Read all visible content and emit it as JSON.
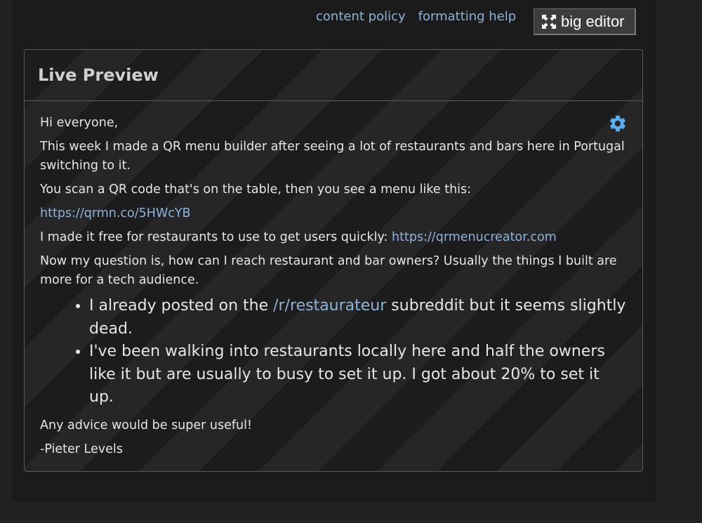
{
  "toolbar": {
    "content_policy": "content policy",
    "formatting_help": "formatting help",
    "big_editor": "big editor"
  },
  "preview": {
    "title": "Live Preview",
    "greeting": "Hi everyone,",
    "para1": "This week I made a QR menu builder after seeing a lot of restaurants and bars here in Portugal switching to it.",
    "para2": "You scan a QR code that's on the table, then you see a menu like this:",
    "link1": "https://qrmn.co/5HWcYB",
    "para3_text": "I made it free for restaurants to use to get users quickly: ",
    "link2": "https://qrmenucreator.com",
    "para4": "Now my question is, how can I reach restaurant and bar owners? Usually the things I built are more for a tech audience.",
    "bullets": [
      {
        "before": "I already posted on the ",
        "link": "/r/restaurateur",
        "after": " subreddit but it seems slightly dead."
      },
      {
        "text": "I've been walking into restaurants locally here and half the owners like it but are usually to busy to set it up. I got about 20% to set it up."
      }
    ],
    "closing": "Any advice would be super useful!",
    "signature": "-Pieter Levels"
  },
  "colors": {
    "link": "#8cb3d9",
    "text": "#e6e6e6",
    "gear": "#5aaef2"
  },
  "icons": {
    "gear": "gear-icon",
    "expand": "expand-arrows-icon"
  }
}
